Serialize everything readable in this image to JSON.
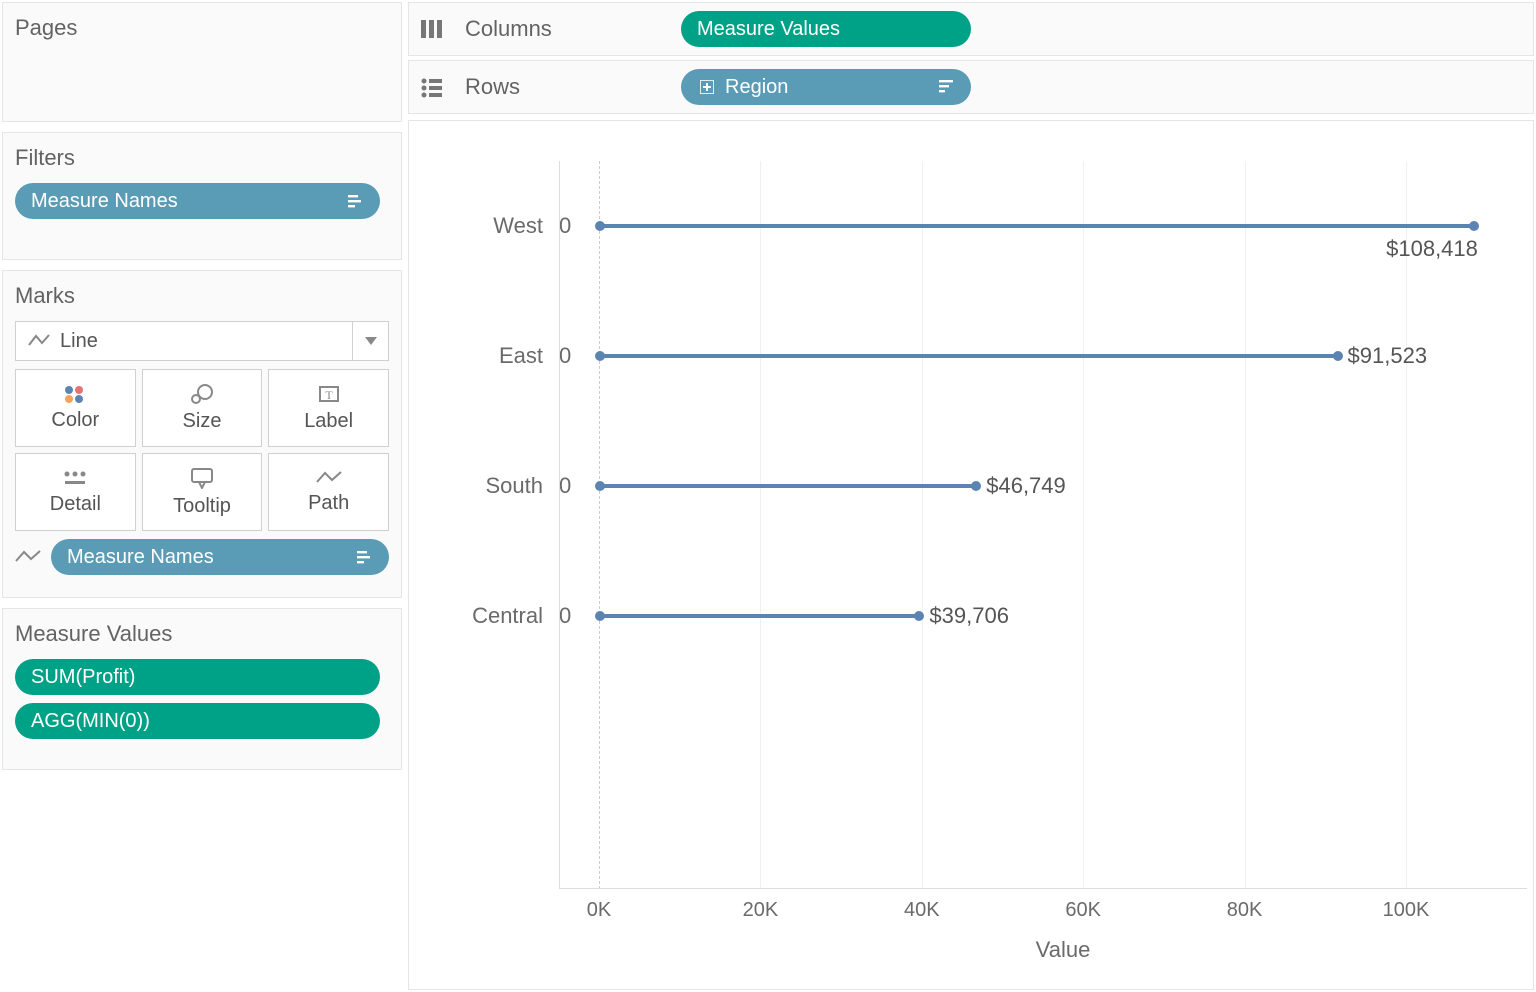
{
  "sidebar": {
    "pages_title": "Pages",
    "filters_title": "Filters",
    "filters_pill": "Measure Names",
    "marks_title": "Marks",
    "marks_type": "Line",
    "mark_buttons": {
      "color": "Color",
      "size": "Size",
      "label": "Label",
      "detail": "Detail",
      "tooltip": "Tooltip",
      "path": "Path"
    },
    "path_pill": "Measure Names",
    "measure_values_title": "Measure Values",
    "measure_values_pills": [
      "SUM(Profit)",
      "AGG(MIN(0))"
    ]
  },
  "shelves": {
    "columns_label": "Columns",
    "columns_pill": "Measure Values",
    "rows_label": "Rows",
    "rows_pill": "Region"
  },
  "chart_data": {
    "type": "bar",
    "xlabel": "Value",
    "ylabel": "",
    "ticks": [
      "0K",
      "20K",
      "40K",
      "60K",
      "80K",
      "100K"
    ],
    "xmax": 115000,
    "categories": [
      "West",
      "East",
      "South",
      "Central"
    ],
    "start_values": [
      0,
      0,
      0,
      0
    ],
    "values": [
      108418,
      91523,
      46749,
      39706
    ],
    "start_labels": [
      "0",
      "0",
      "0",
      "0"
    ],
    "value_labels": [
      "$108,418",
      "$91,523",
      "$46,749",
      "$39,706"
    ],
    "series_color": "#5b84b1"
  }
}
